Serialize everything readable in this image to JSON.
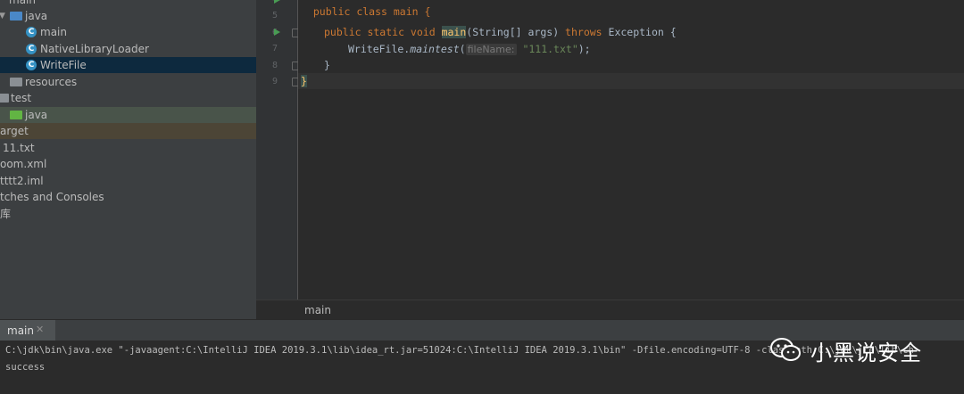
{
  "project_tree": {
    "items": [
      {
        "label": "main"
      },
      {
        "label": "java"
      },
      {
        "label": "main"
      },
      {
        "label": "NativeLibraryLoader"
      },
      {
        "label": "WriteFile"
      },
      {
        "label": "resources"
      },
      {
        "label": "test"
      },
      {
        "label": "java"
      },
      {
        "label": "arget"
      },
      {
        "label": "11.txt"
      },
      {
        "label": "oom.xml"
      },
      {
        "label": "tttt2.iml"
      },
      {
        "label": "tches and Consoles"
      },
      {
        "label": "库"
      }
    ]
  },
  "editor": {
    "line_numbers": [
      "4",
      "5",
      "6",
      "7",
      "8",
      "9"
    ],
    "line4": "public class main {",
    "line6_a": "public static void ",
    "line6_main": "main",
    "line6_b": "(String[] args) ",
    "line6_throws": "throws",
    "line6_c": " Exception {",
    "line7_a": "WriteFile.",
    "line7_method": "maintest",
    "line7_paren": "(",
    "line7_hint": "fileName:",
    "line7_str": "\"111.txt\"",
    "line7_end": ");",
    "line8": "}",
    "line9": "}",
    "breadcrumb": "main"
  },
  "run_panel": {
    "tab_label": "main",
    "console_lines": [
      "C:\\jdk\\bin\\java.exe \"-javaagent:C:\\IntelliJ IDEA 2019.3.1\\lib\\idea_rt.jar=51024:C:\\IntelliJ IDEA 2019.3.1\\bin\" -Dfile.encoding=UTF-8 -classpath C:\\jdk\\jre\\lib\\ch",
      "success"
    ]
  },
  "watermark": {
    "text": "小黑说安全"
  },
  "colors": {
    "keyword": "#cc7832",
    "string": "#6a8759",
    "function": "#ffc66d",
    "selection": "#0d293e"
  }
}
